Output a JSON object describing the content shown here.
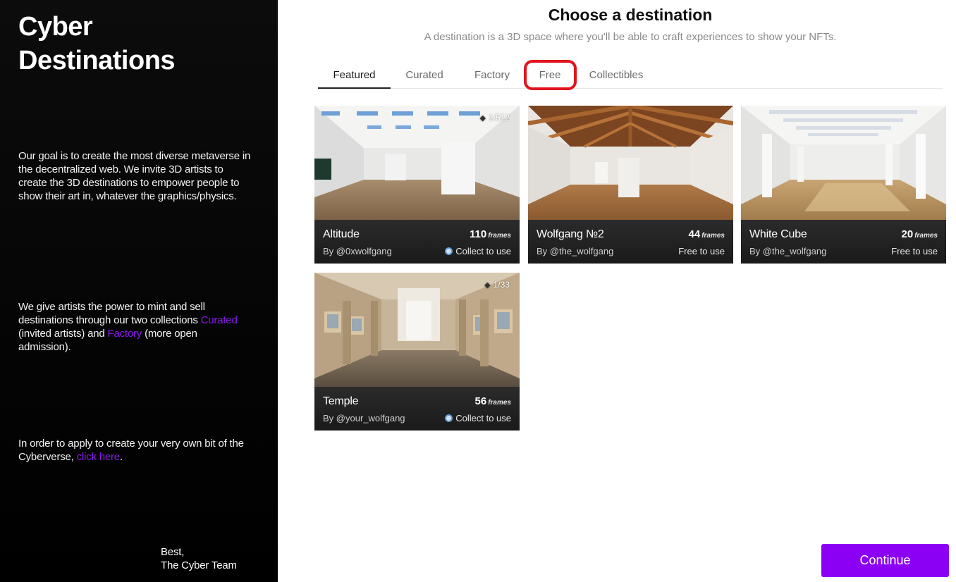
{
  "sidebar": {
    "brand_line1": "Cyber",
    "brand_line2": "Destinations",
    "para1": "Our goal is to create the most diverse metaverse in the decentralized web. We invite 3D artists to create the 3D destinations to empower people to show their art in, whatever the graphics/physics.",
    "para2_start": "We give artists the power to mint and sell destinations through our two collections ",
    "para2_link1": "Curated",
    "para2_mid": " (invited artists) and ",
    "para2_link2": "Factory",
    "para2_end": " (more open admission).",
    "para3_start": "In order to apply to create your very own bit of the Cyberverse, ",
    "para3_link": "click here",
    "para3_end": ".",
    "signoff_line1": "Best,",
    "signoff_line2": "The Cyber Team",
    "link_color": "#8b18f0"
  },
  "main": {
    "title": "Choose a destination",
    "subtitle": "A destination is a 3D space where you'll be able to craft experiences to show your NFTs.",
    "tabs": [
      {
        "label": "Featured",
        "active": true
      },
      {
        "label": "Curated",
        "active": false
      },
      {
        "label": "Factory",
        "active": false
      },
      {
        "label": "Free",
        "active": false,
        "highlighted": true
      },
      {
        "label": "Collectibles",
        "active": false
      }
    ],
    "highlight_color": "#e1141d",
    "frames_unit": "frames",
    "cards": [
      {
        "title": "Altitude",
        "frames": "110",
        "author": "By @0xwolfgang",
        "use": "Collect to use",
        "edition": "1/512",
        "icon": "collect-icon"
      },
      {
        "title": "Wolfgang №2",
        "frames": "44",
        "author": "By @the_wolfgang",
        "use": "Free to use"
      },
      {
        "title": "White Cube",
        "frames": "20",
        "author": "By @the_wolfgang",
        "use": "Free to use"
      },
      {
        "title": "Temple",
        "frames": "56",
        "author": "By @your_wolfgang",
        "use": "Collect to use",
        "edition": "1/33",
        "icon": "collect-icon"
      }
    ],
    "continue_label": "Continue",
    "accent_color": "#8b00f5"
  }
}
